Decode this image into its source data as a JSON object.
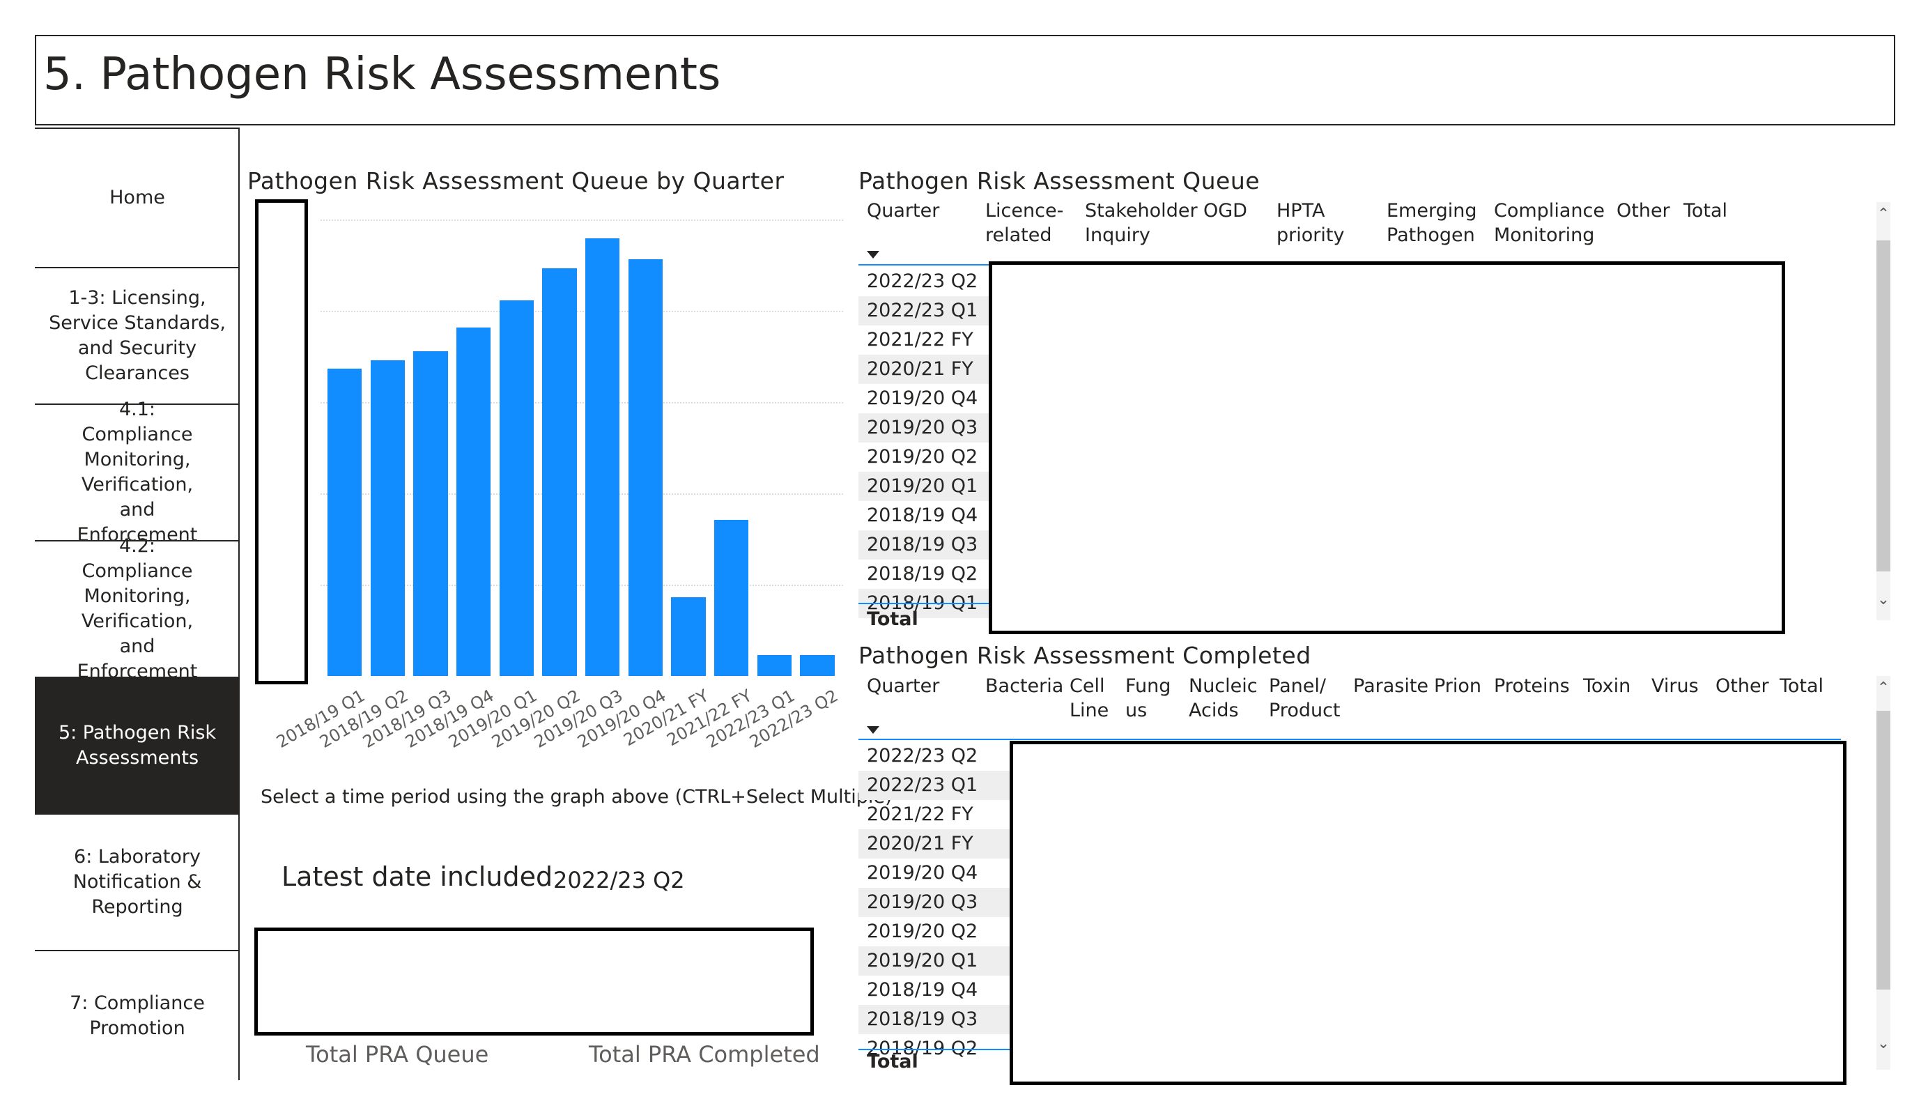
{
  "page": {
    "title": "5. Pathogen Risk Assessments"
  },
  "sidebar": {
    "items": [
      {
        "label": "Home",
        "active": false
      },
      {
        "label": "1-3: Licensing, Service Standards, and Security Clearances",
        "active": false
      },
      {
        "label": "4.1: Compliance Monitoring, Verification, and Enforcement",
        "active": false
      },
      {
        "label": "4.2: Compliance Monitoring, Verification, and Enforcement",
        "active": false
      },
      {
        "label": "5: Pathogen Risk Assessments",
        "active": true
      },
      {
        "label": "6: Laboratory Notification & Reporting",
        "active": false
      },
      {
        "label": "7: Compliance Promotion",
        "active": false
      }
    ]
  },
  "queue_chart": {
    "title": "Pathogen Risk Assessment Queue by Quarter",
    "hint": "Select a time period using the graph above (CTRL+Select Multiple)"
  },
  "chart_data": {
    "type": "bar",
    "title": "Pathogen Risk Assessment Queue by Quarter",
    "categories": [
      "2018/19 Q1",
      "2018/19 Q2",
      "2018/19 Q3",
      "2018/19 Q4",
      "2019/20 Q1",
      "2019/20 Q2",
      "2019/20 Q3",
      "2019/20 Q4",
      "2020/21 FY",
      "2021/22 FY",
      "2022/23 Q1",
      "2022/23 Q2"
    ],
    "values": [
      41.4,
      42.6,
      43.8,
      47.0,
      50.6,
      55.0,
      59.0,
      56.2,
      10.6,
      21.0,
      2.8,
      2.8
    ],
    "ylim": [
      0,
      62
    ],
    "color": "#118dff",
    "grid": true,
    "y_axis_labels_redacted": true
  },
  "latest": {
    "label": "Latest date included",
    "value": "2022/23 Q2"
  },
  "cards": {
    "queue_label": "Total PRA Queue",
    "completed_label": "Total PRA Completed"
  },
  "queue_table": {
    "title": "Pathogen Risk Assessment Queue",
    "headers": [
      [
        "Quarter"
      ],
      [
        "Licence-",
        "related"
      ],
      [
        "Stakeholder",
        "Inquiry"
      ],
      [
        "OGD"
      ],
      [
        "HPTA",
        "priority"
      ],
      [
        "Emerging",
        "Pathogen"
      ],
      [
        "Compliance",
        "Monitoring"
      ],
      [
        "Other"
      ],
      [
        "Total"
      ]
    ],
    "rows": [
      "2022/23 Q2",
      "2022/23 Q1",
      "2021/22 FY",
      "2020/21 FY",
      "2019/20 Q4",
      "2019/20 Q3",
      "2019/20 Q2",
      "2019/20 Q1",
      "2018/19 Q4",
      "2018/19 Q3",
      "2018/19 Q2",
      "2018/19 Q1"
    ],
    "total_label": "Total"
  },
  "completed_table": {
    "title": "Pathogen Risk Assessment Completed",
    "headers": [
      [
        "Quarter"
      ],
      [
        "Bacteria"
      ],
      [
        "Cell",
        "Line"
      ],
      [
        "Fung",
        "us"
      ],
      [
        "Nucleic",
        "Acids"
      ],
      [
        "Panel/",
        "Product"
      ],
      [
        "Parasite"
      ],
      [
        "Prion"
      ],
      [
        "Proteins"
      ],
      [
        "Toxin"
      ],
      [
        "Virus"
      ],
      [
        "Other"
      ],
      [
        "Total"
      ]
    ],
    "rows": [
      "2022/23 Q2",
      "2022/23 Q1",
      "2021/22 FY",
      "2020/21 FY",
      "2019/20 Q4",
      "2019/20 Q3",
      "2019/20 Q2",
      "2019/20 Q1",
      "2018/19 Q4",
      "2018/19 Q3",
      "2018/19 Q2"
    ],
    "total_label": "Total"
  },
  "colors": {
    "accent": "#118dff",
    "dark": "#252423",
    "row_alt": "#eeeeee"
  },
  "icons": {
    "sort": "sort-desc-icon",
    "scroll_up": "chevron-up-icon",
    "scroll_down": "chevron-down-icon"
  }
}
